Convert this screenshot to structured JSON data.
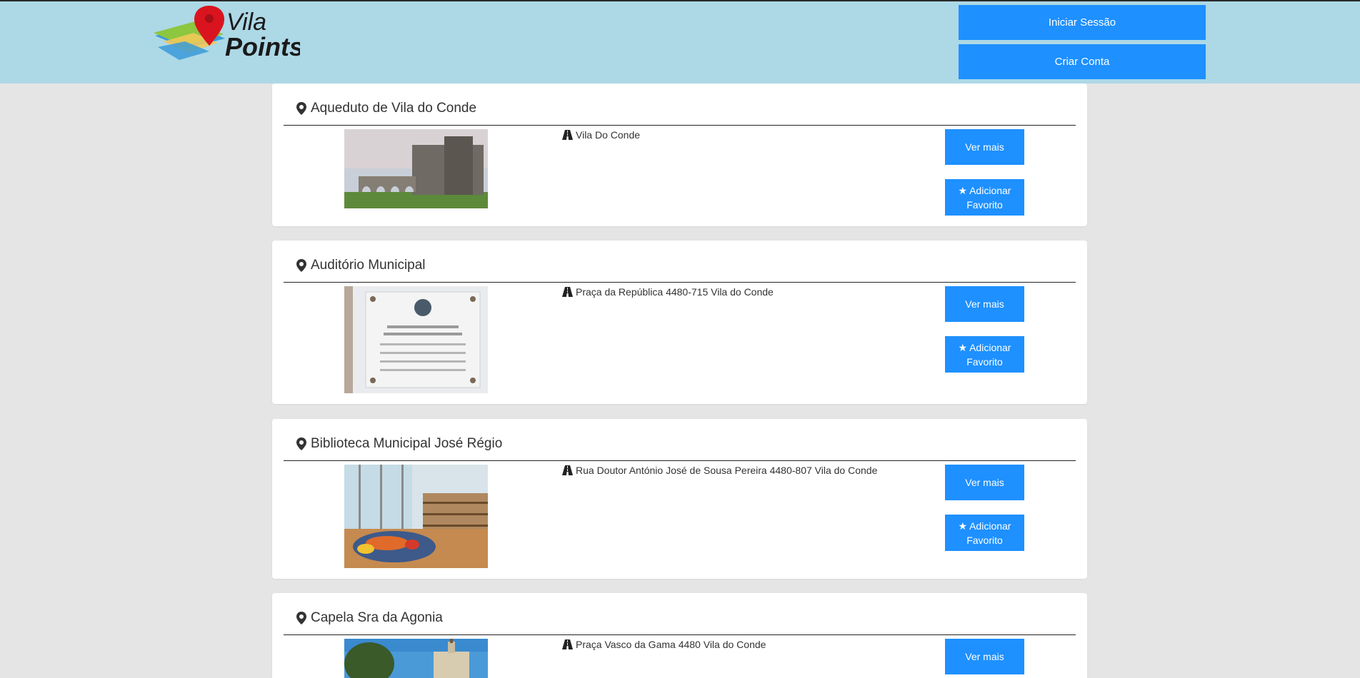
{
  "header": {
    "logo_text_top": "Vila",
    "logo_text_bottom": "Points",
    "login_label": "Iniciar Sessão",
    "signup_label": "Criar Conta"
  },
  "colors": {
    "header_bg": "#add8e6",
    "accent": "#1e90ff",
    "page_bg": "#e5e5e5"
  },
  "points": [
    {
      "title": "Aqueduto de Vila do Conde",
      "address": "Vila Do Conde",
      "more_label": "Ver mais",
      "fav_label_1": "Adicionar",
      "fav_label_2": "Favorito",
      "image": "aqueduct-monastery-photo"
    },
    {
      "title": "Auditório Municipal",
      "address": "Praça da República 4480-715 Vila do Conde",
      "more_label": "Ver mais",
      "fav_label_1": "Adicionar",
      "fav_label_2": "Favorito",
      "image": "auditorium-plaque-photo"
    },
    {
      "title": "Biblioteca Municipal José Régio",
      "address": "Rua Doutor António José de Sousa Pereira 4480-807 Vila do Conde",
      "more_label": "Ver mais",
      "fav_label_1": "Adicionar",
      "fav_label_2": "Favorito",
      "image": "library-interior-photo"
    },
    {
      "title": "Capela Sra da Agonia",
      "address": "Praça Vasco da Gama 4480 Vila do Conde",
      "more_label": "Ver mais",
      "image": "chapel-photo"
    }
  ],
  "icons": {
    "title_icon": "map-marker-icon",
    "address_icon": "road-icon",
    "fav_icon": "star-icon"
  }
}
